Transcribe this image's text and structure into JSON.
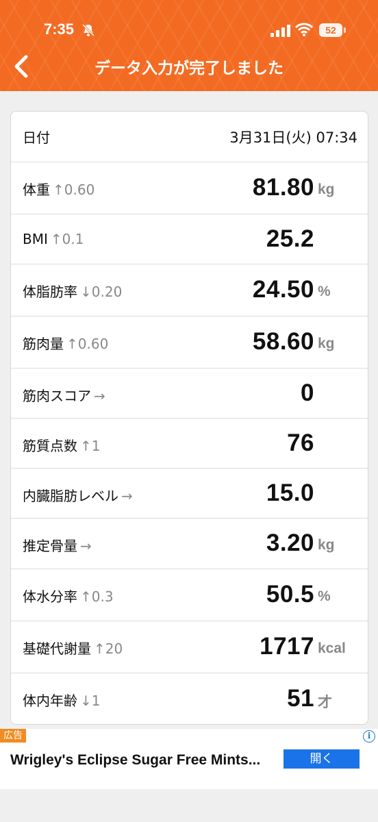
{
  "status_bar": {
    "time": "7:35",
    "battery": "52"
  },
  "nav": {
    "title": "データ入力が完了しました"
  },
  "rows": [
    {
      "label": "日付",
      "value": "3月31日(火) 07:34"
    },
    {
      "label": "体重",
      "delta": "↑0.60",
      "value": "81.80",
      "unit": "kg"
    },
    {
      "label": "BMI",
      "delta": "↑0.1",
      "value": "25.2",
      "unit": ""
    },
    {
      "label": "体脂肪率",
      "delta": "↓0.20",
      "value": "24.50",
      "unit": "%"
    },
    {
      "label": "筋肉量",
      "delta": "↑0.60",
      "value": "58.60",
      "unit": "kg"
    },
    {
      "label": "筋肉スコア",
      "delta": "→",
      "value": "0",
      "unit": ""
    },
    {
      "label": "筋質点数",
      "delta": "↑1",
      "value": "76",
      "unit": ""
    },
    {
      "label": "内臓脂肪レベル",
      "delta": "→",
      "value": "15.0",
      "unit": ""
    },
    {
      "label": "推定骨量",
      "delta": "→",
      "value": "3.20",
      "unit": "kg"
    },
    {
      "label": "体水分率",
      "delta": "↑0.3",
      "value": "50.5",
      "unit": "%"
    },
    {
      "label": "基礎代謝量",
      "delta": "↑20",
      "value": "1717",
      "unit": "kcal"
    },
    {
      "label": "体内年齢",
      "delta": "↓1",
      "value": "51",
      "unit": "才"
    }
  ],
  "ad": {
    "badge": "広告",
    "info": "i",
    "text": "Wrigley's Eclipse Sugar Free Mints...",
    "button": "開く"
  },
  "colors": {
    "header": "#f36b22",
    "ad_button": "#1a73e8",
    "ad_badge": "#f18c22"
  }
}
